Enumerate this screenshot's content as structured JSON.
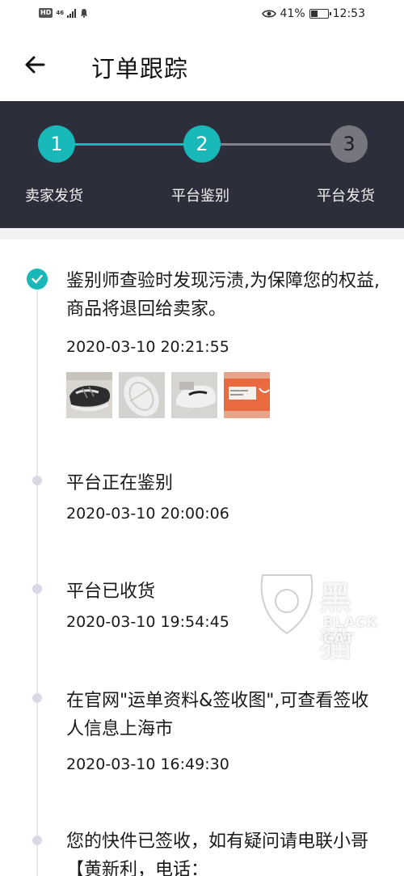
{
  "status_bar": {
    "hd_badge": "HD",
    "network": "46",
    "battery_level": 0.41,
    "battery_text": "41%",
    "time": "12:53",
    "icons": [
      "signal-icon",
      "notification-bell-icon",
      "eye-icon",
      "battery-icon"
    ]
  },
  "header": {
    "title": "订单跟踪",
    "back_icon": "back-arrow-icon"
  },
  "steps": [
    {
      "number": "1",
      "label": "卖家发货",
      "state": "done"
    },
    {
      "number": "2",
      "label": "平台鉴别",
      "state": "active"
    },
    {
      "number": "3",
      "label": "平台发货",
      "state": "pending"
    }
  ],
  "colors": {
    "accent": "#18b7b8",
    "step_bar_bg": "#2c2e3b",
    "inactive_step": "#76777e"
  },
  "timeline": [
    {
      "text": "鉴别师查验时发现污渍,为保障您的权益,商品将退回给卖家。",
      "time": "2020-03-10 20:21:55",
      "icon": "check-icon",
      "photos": [
        "shoe-photo-top",
        "shoe-photo-sole",
        "shoe-photo-side",
        "shoebox-photo"
      ]
    },
    {
      "text": "平台正在鉴别",
      "time": "2020-03-10 20:00:06"
    },
    {
      "text": "平台已收货",
      "time": "2020-03-10 19:54:45"
    },
    {
      "text": "在官网\"运单资料&签收图\",可查看签收人信息上海市",
      "time": "2020-03-10 16:49:30"
    },
    {
      "text": "您的快件已签收，如有疑问请电联小哥【黄新利，电话："
    }
  ],
  "watermark": {
    "chinese": "黑猫",
    "english": "BLACK CAT"
  }
}
